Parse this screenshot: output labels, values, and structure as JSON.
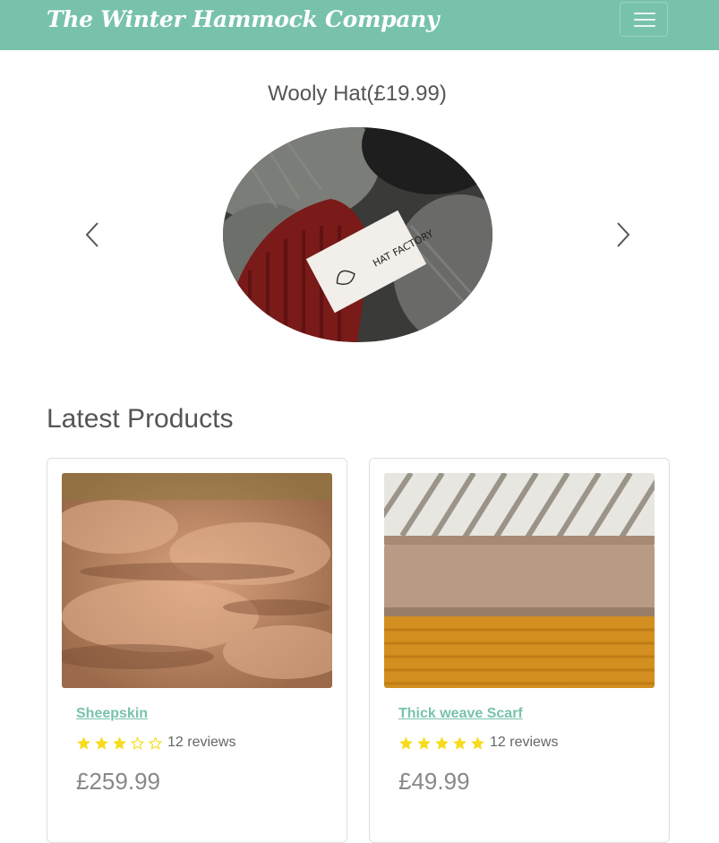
{
  "navbar": {
    "brand": "The Winter Hammock Company",
    "toggler_icon": "hamburger-menu-icon",
    "color": "#78c2ad"
  },
  "carousel": {
    "caption": "Wooly Hat(£19.99)",
    "prev_icon": "chevron-left-icon",
    "next_icon": "chevron-right-icon"
  },
  "latest": {
    "title": "Latest Products",
    "products": [
      {
        "name": "Sheepskin",
        "rating": 3,
        "max_rating": 5,
        "reviews": "12 reviews",
        "price": "£259.99"
      },
      {
        "name": "Thick weave Scarf",
        "rating": 5,
        "max_rating": 5,
        "reviews": "12 reviews",
        "price": "£49.99"
      }
    ]
  },
  "colors": {
    "accent": "#78c2ad",
    "star": "#f7dc1e",
    "text": "#555555"
  }
}
